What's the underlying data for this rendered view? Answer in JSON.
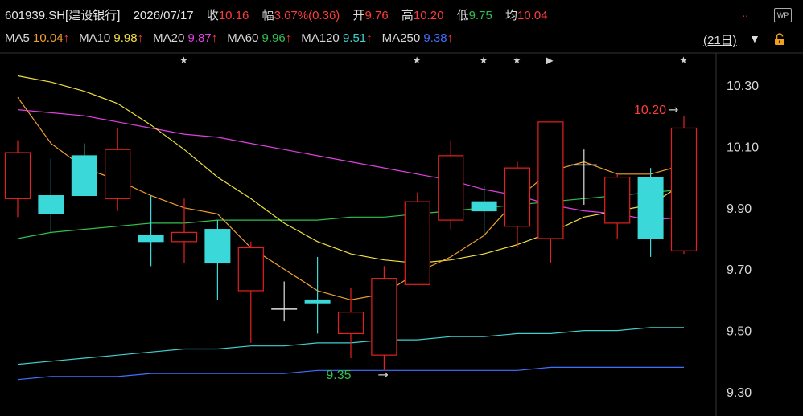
{
  "header": {
    "symbol": "601939.SH[建设银行]",
    "date": "2026/07/17",
    "close_label": "收",
    "close": "10.16",
    "change_label": "幅",
    "change": "3.67%(0.36)",
    "open_label": "开",
    "open": "9.76",
    "high_label": "高",
    "high": "10.20",
    "low_label": "低",
    "low": "9.75",
    "avg_label": "均",
    "avg": "10.04",
    "more": "..",
    "wp_label": "WP"
  },
  "ma": [
    {
      "label": "MA5",
      "value": "10.04",
      "arrow": "↑",
      "color": "#f0a030"
    },
    {
      "label": "MA10",
      "value": "9.98",
      "arrow": "↑",
      "color": "#f0e040"
    },
    {
      "label": "MA20",
      "value": "9.87",
      "arrow": "↑",
      "color": "#e040e0"
    },
    {
      "label": "MA60",
      "value": "9.96",
      "arrow": "↑",
      "color": "#30c050"
    },
    {
      "label": "MA120",
      "value": "9.51",
      "arrow": "↑",
      "color": "#40d0d0"
    },
    {
      "label": "MA250",
      "value": "9.38",
      "arrow": "↑",
      "color": "#4070ff"
    }
  ],
  "period": {
    "label": "(21日)",
    "arrow": "▼"
  },
  "chart_data": {
    "type": "candlestick",
    "ylim": [
      9.27,
      10.4
    ],
    "yticks": [
      "10.30",
      "10.10",
      "9.90",
      "9.70",
      "9.50",
      "9.30"
    ],
    "candles": [
      {
        "o": 9.93,
        "c": 10.08,
        "h": 10.12,
        "l": 9.87
      },
      {
        "o": 9.94,
        "c": 9.88,
        "h": 10.06,
        "l": 9.82
      },
      {
        "o": 10.07,
        "c": 9.94,
        "h": 10.11,
        "l": 9.94
      },
      {
        "o": 9.93,
        "c": 10.09,
        "h": 10.16,
        "l": 9.89
      },
      {
        "o": 9.81,
        "c": 9.79,
        "h": 9.94,
        "l": 9.71
      },
      {
        "o": 9.79,
        "c": 9.82,
        "h": 9.93,
        "l": 9.72
      },
      {
        "o": 9.83,
        "c": 9.72,
        "h": 9.86,
        "l": 9.6
      },
      {
        "o": 9.63,
        "c": 9.77,
        "h": 9.79,
        "l": 9.46
      },
      {
        "o": 9.57,
        "c": 9.57,
        "h": 9.66,
        "l": 9.53
      },
      {
        "o": 9.6,
        "c": 9.59,
        "h": 9.74,
        "l": 9.49
      },
      {
        "o": 9.49,
        "c": 9.56,
        "h": 9.64,
        "l": 9.41
      },
      {
        "o": 9.42,
        "c": 9.67,
        "h": 9.71,
        "l": 9.37
      },
      {
        "o": 9.65,
        "c": 9.92,
        "h": 9.95,
        "l": 9.65
      },
      {
        "o": 9.86,
        "c": 10.07,
        "h": 10.12,
        "l": 9.83
      },
      {
        "o": 9.92,
        "c": 9.89,
        "h": 9.97,
        "l": 9.81
      },
      {
        "o": 9.84,
        "c": 10.03,
        "h": 10.05,
        "l": 9.77
      },
      {
        "o": 9.8,
        "c": 10.18,
        "h": 10.18,
        "l": 9.72
      },
      {
        "o": 10.04,
        "c": 10.04,
        "h": 10.09,
        "l": 9.91
      },
      {
        "o": 9.85,
        "c": 10.0,
        "h": 10.01,
        "l": 9.8
      },
      {
        "o": 10.0,
        "c": 9.8,
        "h": 10.03,
        "l": 9.74
      },
      {
        "o": 9.76,
        "c": 10.16,
        "h": 10.2,
        "l": 9.75
      }
    ],
    "ma5": [
      10.26,
      10.11,
      10.03,
      9.99,
      9.94,
      9.9,
      9.88,
      9.77,
      9.7,
      9.63,
      9.6,
      9.62,
      9.69,
      9.74,
      9.81,
      9.93,
      10.02,
      10.05,
      10.01,
      10.01,
      10.04
    ],
    "ma10": [
      10.33,
      10.31,
      10.28,
      10.24,
      10.17,
      10.09,
      10.0,
      9.93,
      9.85,
      9.79,
      9.75,
      9.73,
      9.72,
      9.73,
      9.75,
      9.78,
      9.82,
      9.87,
      9.89,
      9.91,
      9.98
    ],
    "ma20": [
      10.22,
      10.21,
      10.2,
      10.18,
      10.16,
      10.14,
      10.13,
      10.11,
      10.09,
      10.07,
      10.05,
      10.03,
      10.01,
      9.99,
      9.96,
      9.94,
      9.91,
      9.89,
      9.88,
      9.86,
      9.87
    ],
    "ma60": [
      9.8,
      9.82,
      9.83,
      9.84,
      9.85,
      9.85,
      9.86,
      9.86,
      9.86,
      9.86,
      9.87,
      9.87,
      9.88,
      9.89,
      9.9,
      9.91,
      9.92,
      9.93,
      9.94,
      9.95,
      9.96
    ],
    "ma120": [
      9.39,
      9.4,
      9.41,
      9.42,
      9.43,
      9.44,
      9.44,
      9.45,
      9.45,
      9.46,
      9.46,
      9.47,
      9.47,
      9.48,
      9.48,
      9.49,
      9.49,
      9.5,
      9.5,
      9.51,
      9.51
    ],
    "ma250": [
      9.34,
      9.35,
      9.35,
      9.35,
      9.36,
      9.36,
      9.36,
      9.36,
      9.36,
      9.37,
      9.37,
      9.37,
      9.37,
      9.37,
      9.37,
      9.37,
      9.38,
      9.38,
      9.38,
      9.38,
      9.38
    ],
    "markers": [
      {
        "index": 5,
        "symbol": "★"
      },
      {
        "index": 12,
        "symbol": "★"
      },
      {
        "index": 14,
        "symbol": "★"
      },
      {
        "index": 15,
        "symbol": "★"
      },
      {
        "index": 16,
        "symbol": "▶"
      },
      {
        "index": 20,
        "symbol": "★"
      }
    ],
    "high_annotation": {
      "index": 20,
      "value": "10.20",
      "arrow": "→"
    },
    "low_annotation": {
      "index": 11,
      "value": "9.35",
      "arrow": "→"
    },
    "colors": {
      "up": "#e52020",
      "down": "#3ad8d8",
      "flat": "#e0e0e0",
      "grid": "#2a2a2a"
    }
  }
}
